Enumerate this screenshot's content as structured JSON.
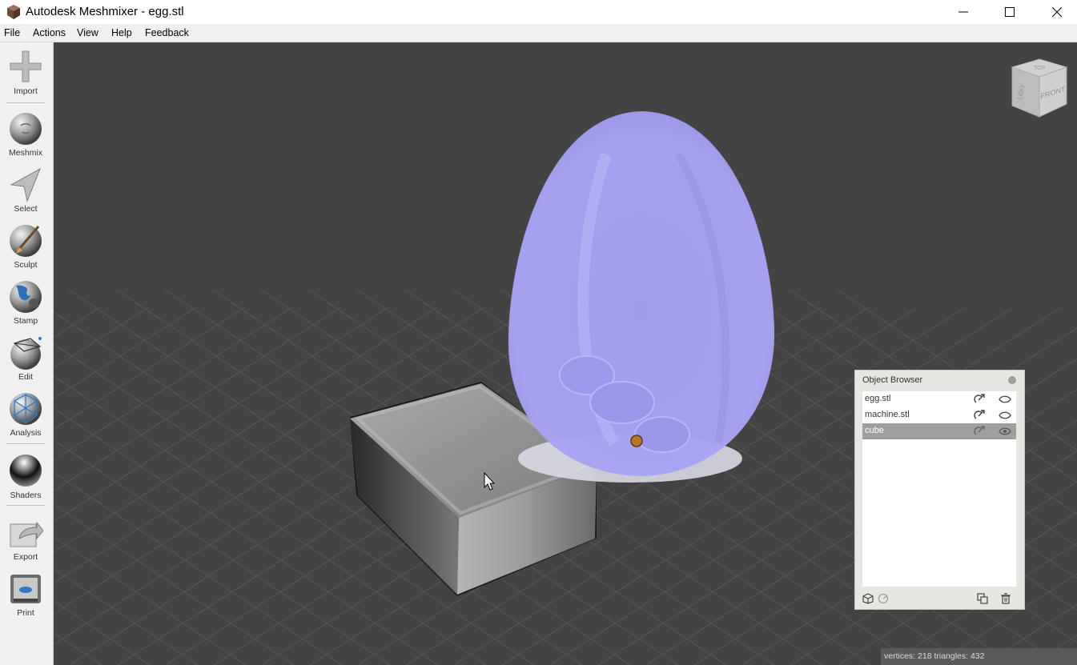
{
  "window": {
    "title": "Autodesk Meshmixer - egg.stl"
  },
  "menu": [
    "File",
    "Actions",
    "View",
    "Help",
    "Feedback"
  ],
  "toolbar": [
    {
      "label": "Import",
      "icon": "plus-icon"
    },
    {
      "label": "Meshmix",
      "icon": "meshmix-icon"
    },
    {
      "label": "Select",
      "icon": "select-arrow-icon"
    },
    {
      "label": "Sculpt",
      "icon": "sculpt-brush-icon"
    },
    {
      "label": "Stamp",
      "icon": "stamp-icon"
    },
    {
      "label": "Edit",
      "icon": "edit-icon"
    },
    {
      "label": "Analysis",
      "icon": "analysis-icon"
    },
    {
      "label": "Shaders",
      "icon": "shaders-icon"
    },
    {
      "label": "Export",
      "icon": "export-icon"
    },
    {
      "label": "Print",
      "icon": "print-icon"
    }
  ],
  "viewcube": {
    "top": "TOP",
    "left": "LEFT",
    "front": "FRONT"
  },
  "object_browser": {
    "title": "Object Browser",
    "items": [
      {
        "name": "egg.stl",
        "selected": false
      },
      {
        "name": "machine.stl",
        "selected": false
      },
      {
        "name": "cube",
        "selected": true
      }
    ]
  },
  "status": {
    "text": "vertices: 218 triangles: 432"
  },
  "colors": {
    "viewport_bg": "#444343",
    "egg_fill": "#a7a3f2",
    "selection_row": "#a09f9d"
  }
}
